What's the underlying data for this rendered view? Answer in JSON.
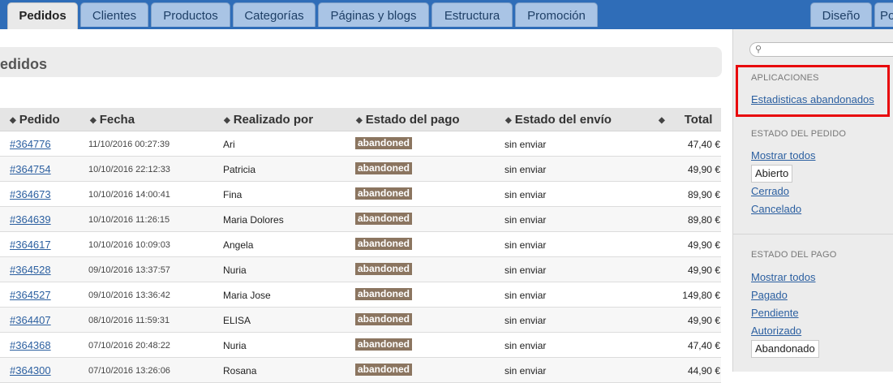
{
  "tabs": [
    {
      "label": "Pedidos",
      "active": true
    },
    {
      "label": "Clientes"
    },
    {
      "label": "Productos"
    },
    {
      "label": "Categorías"
    },
    {
      "label": "Páginas y blogs"
    },
    {
      "label": "Estructura"
    },
    {
      "label": "Promoción"
    }
  ],
  "right_tabs": [
    {
      "label": "Diseño"
    },
    {
      "label": "Po"
    }
  ],
  "page_title": "edidos",
  "table": {
    "columns": [
      "Pedido",
      "Fecha",
      "Realizado por",
      "Estado del pago",
      "Estado del envío",
      "Total"
    ],
    "rows": [
      {
        "id": "#364776",
        "date": "11/10/2016 00:27:39",
        "by": "Ari",
        "payment": "abandoned",
        "shipping": "sin enviar",
        "total": "47,40 €"
      },
      {
        "id": "#364754",
        "date": "10/10/2016 22:12:33",
        "by": "Patricia",
        "payment": "abandoned",
        "shipping": "sin enviar",
        "total": "49,90 €"
      },
      {
        "id": "#364673",
        "date": "10/10/2016 14:00:41",
        "by": "Fina",
        "payment": "abandoned",
        "shipping": "sin enviar",
        "total": "89,90 €"
      },
      {
        "id": "#364639",
        "date": "10/10/2016 11:26:15",
        "by": "Maria Dolores",
        "payment": "abandoned",
        "shipping": "sin enviar",
        "total": "89,80 €"
      },
      {
        "id": "#364617",
        "date": "10/10/2016 10:09:03",
        "by": "Angela",
        "payment": "abandoned",
        "shipping": "sin enviar",
        "total": "49,90 €"
      },
      {
        "id": "#364528",
        "date": "09/10/2016 13:37:57",
        "by": "Nuria",
        "payment": "abandoned",
        "shipping": "sin enviar",
        "total": "49,90 €"
      },
      {
        "id": "#364527",
        "date": "09/10/2016 13:36:42",
        "by": "Maria Jose",
        "payment": "abandoned",
        "shipping": "sin enviar",
        "total": "149,80 €"
      },
      {
        "id": "#364407",
        "date": "08/10/2016 11:59:31",
        "by": "ELISA",
        "payment": "abandoned",
        "shipping": "sin enviar",
        "total": "49,90 €"
      },
      {
        "id": "#364368",
        "date": "07/10/2016 20:48:22",
        "by": "Nuria",
        "payment": "abandoned",
        "shipping": "sin enviar",
        "total": "47,40 €"
      },
      {
        "id": "#364300",
        "date": "07/10/2016 13:26:06",
        "by": "Rosana",
        "payment": "abandoned",
        "shipping": "sin enviar",
        "total": "44,90 €"
      }
    ]
  },
  "sidebar": {
    "search_icon": "search-icon",
    "apps_title": "APLICACIONES",
    "apps_link": "Estadisticas abandonados",
    "order_status_title": "ESTADO DEL PEDIDO",
    "order_status_items": [
      {
        "label": "Mostrar todos",
        "kind": "link"
      },
      {
        "label": "Abierto",
        "kind": "selected"
      },
      {
        "label": "Cerrado",
        "kind": "link"
      },
      {
        "label": "Cancelado",
        "kind": "link"
      }
    ],
    "payment_status_title": "ESTADO DEL PAGO",
    "payment_status_items": [
      {
        "label": "Mostrar todos",
        "kind": "link"
      },
      {
        "label": "Pagado",
        "kind": "link"
      },
      {
        "label": "Pendiente",
        "kind": "link"
      },
      {
        "label": "Autorizado",
        "kind": "link"
      },
      {
        "label": "Abandonado",
        "kind": "selected"
      }
    ]
  },
  "colors": {
    "topbar": "#2f6db8",
    "badge": "#8b7560",
    "link": "#2b5fa0",
    "highlight": "#e8080c"
  }
}
